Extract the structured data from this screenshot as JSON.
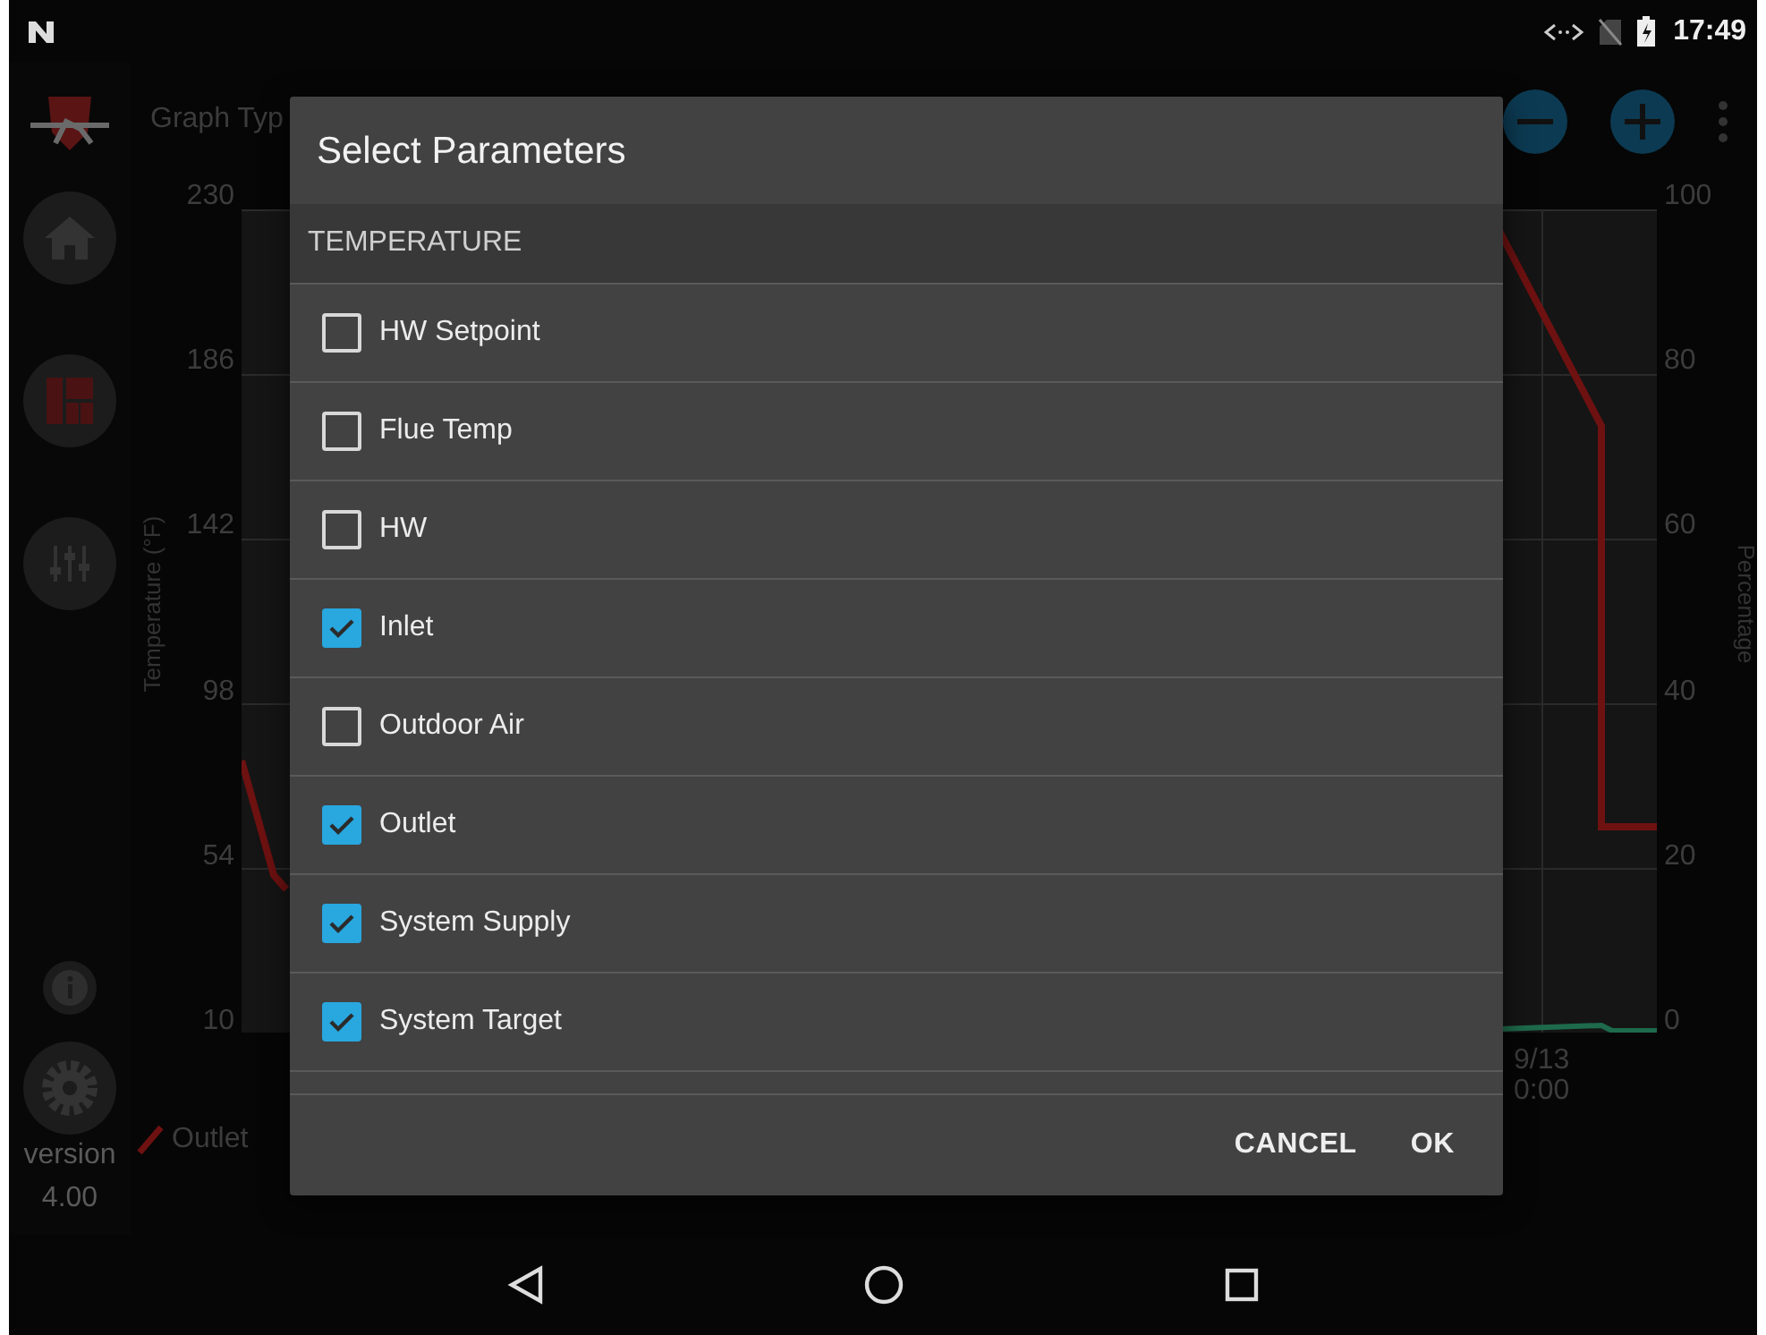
{
  "status_bar": {
    "time": "17:49"
  },
  "app_bar": {
    "title": "Graph Typ"
  },
  "sidebar": {
    "version_label": "version",
    "version": "4.00"
  },
  "chart": {
    "left_axis": {
      "label": "Temperature (°F)",
      "ticks": [
        "230",
        "186",
        "142",
        "98",
        "54",
        "10"
      ]
    },
    "right_axis": {
      "label": "Percentage",
      "ticks": [
        "100",
        "80",
        "60",
        "40",
        "20",
        "0"
      ]
    },
    "x_tick": {
      "date": "9/13",
      "time": "0:00"
    },
    "legend": [
      {
        "label": "Outlet"
      }
    ]
  },
  "dialog": {
    "title": "Select Parameters",
    "section": "TEMPERATURE",
    "items": [
      {
        "label": "HW Setpoint",
        "checked": false
      },
      {
        "label": "Flue Temp",
        "checked": false
      },
      {
        "label": "HW",
        "checked": false
      },
      {
        "label": "Inlet",
        "checked": true
      },
      {
        "label": "Outdoor Air",
        "checked": false
      },
      {
        "label": "Outlet",
        "checked": true
      },
      {
        "label": "System Supply",
        "checked": true
      },
      {
        "label": "System Target",
        "checked": true
      }
    ],
    "buttons": [
      "CANCEL",
      "OK"
    ]
  }
}
